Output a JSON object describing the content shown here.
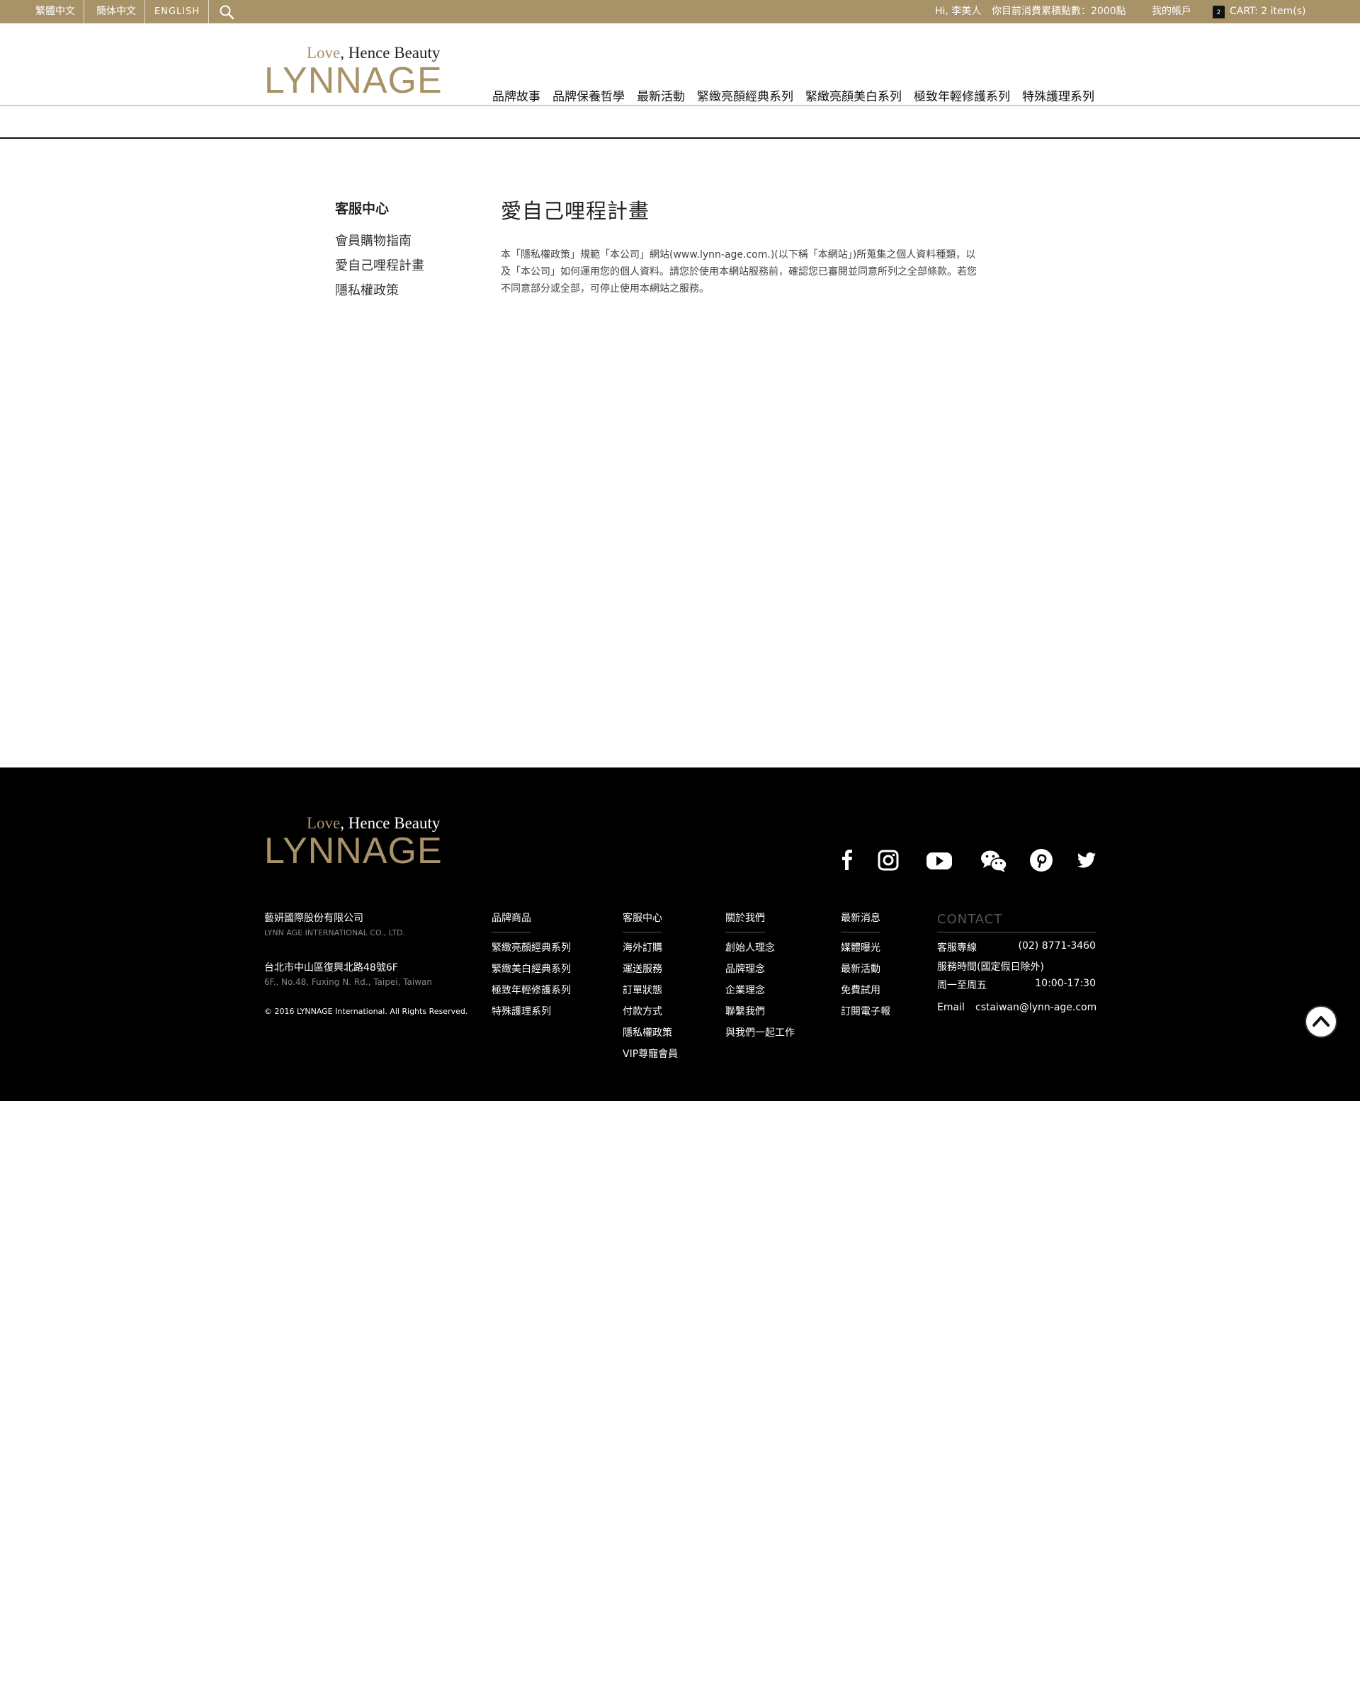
{
  "topbar": {
    "languages": [
      "繁體中文",
      "簡体中文",
      "ENGLISH"
    ],
    "greeting": "Hi, 李美人",
    "points": "你目前消費累積點數：2000點",
    "account": "我的帳戶",
    "cart_count": "2",
    "cart": "CART: 2 item(s)",
    "icons": {
      "search": "search-icon",
      "cart": "shopping-bag-icon"
    }
  },
  "brand": {
    "tag_love": "Love",
    "tag_rest": ", Hence Beauty",
    "name": "LYNNAGE",
    "color": "#a89268"
  },
  "nav": [
    "品牌故事",
    "品牌保養哲學",
    "最新活動",
    "緊緻亮顏經典系列",
    "緊緻亮顏美白系列",
    "極致年輕修護系列",
    "特殊護理系列"
  ],
  "sidebar": {
    "title": "客服中心",
    "items": [
      "會員購物指南",
      "愛自己哩程計畫",
      "隱私權政策"
    ]
  },
  "main": {
    "title": "愛自己哩程計畫",
    "body_lines": [
      "本「隱私權政策」規範「本公司」網站(www.lynn-age.com.)(以下稱「本網站」)所蒐集之個人資料種類，以",
      "及「本公司」如何運用您的個人資料。請您於使用本網站服務前，確認您已審閱並同意所列之全部條款。若您",
      "不同意部分或全部，可停止使用本網站之服務。"
    ]
  },
  "footer": {
    "company": {
      "name_zh": "藝妍國際股份有限公司",
      "name_en": "LYNN AGE INTERNATIONAL CO., LTD.",
      "address_zh": "台北市中山區復興北路48號6F",
      "address_en": "6F., No.48, Fuxing N. Rd., Taipei, Taiwan",
      "copyright": "© 2016 LYNNAGE International. All Rights Reserved."
    },
    "social": [
      "facebook-icon",
      "instagram-icon",
      "youtube-icon",
      "wechat-icon",
      "pinterest-icon",
      "twitter-icon"
    ],
    "columns": [
      {
        "title": "品牌商品",
        "links": [
          "緊緻亮顏經典系列",
          "緊緻美白經典系列",
          "極致年輕修護系列",
          "特殊護理系列"
        ]
      },
      {
        "title": "客服中心",
        "links": [
          "海外訂購",
          "運送服務",
          "訂單狀態",
          "付款方式",
          "隱私權政策",
          "VIP尊寵會員"
        ]
      },
      {
        "title": "關於我們",
        "links": [
          "創始人理念",
          "品牌理念",
          "企業理念",
          "聯繫我們",
          "與我們一起工作"
        ]
      },
      {
        "title": "最新消息",
        "links": [
          "媒體曝光",
          "最新活動",
          "免費試用",
          "訂閱電子報"
        ]
      }
    ],
    "contact": {
      "title": "CONTACT",
      "hotline_label": "客服專線",
      "hotline": "(02) 8771-3460",
      "hours_label": "服務時間(國定假日除外)",
      "days": "周一至周五",
      "hours": "10:00-17:30",
      "email_label": "Email",
      "email": "cstaiwan@lynn-age.com"
    },
    "backtop_icon": "chevron-up-icon"
  }
}
